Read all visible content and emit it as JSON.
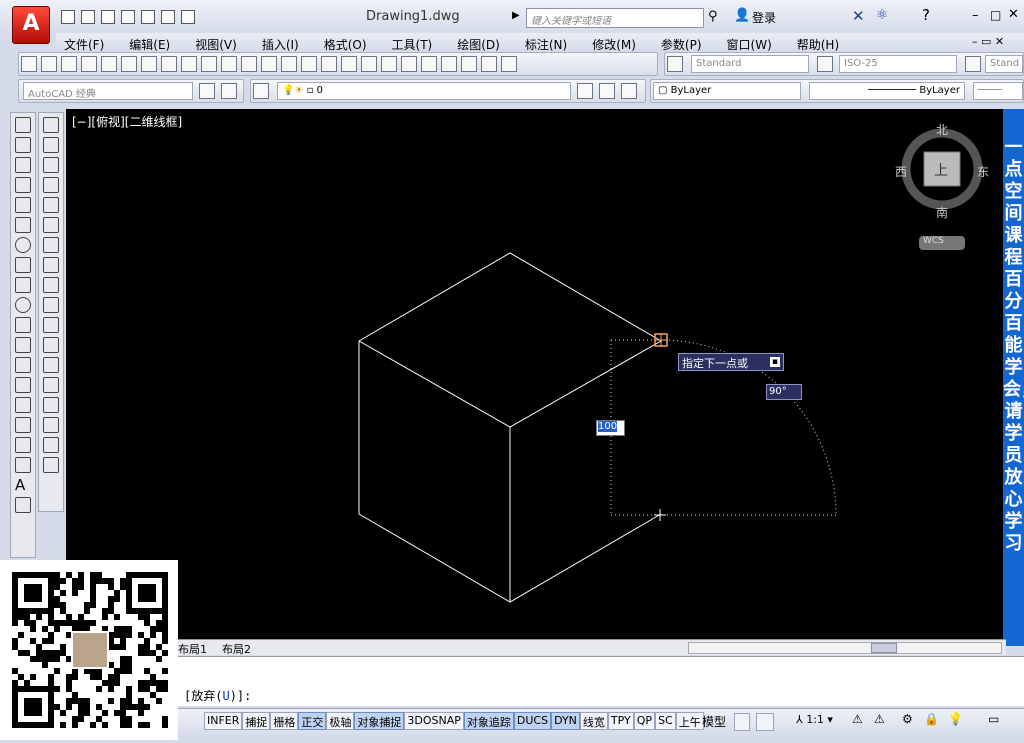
{
  "app": {
    "doc_title": "Drawing1.dwg",
    "search_placeholder": "键入关键字或短语",
    "login": "登录",
    "app_letter": "A"
  },
  "menu": [
    "文件(F)",
    "编辑(E)",
    "视图(V)",
    "插入(I)",
    "格式(O)",
    "工具(T)",
    "绘图(D)",
    "标注(N)",
    "修改(M)",
    "参数(P)",
    "窗口(W)",
    "帮助(H)"
  ],
  "toolbar": {
    "text_style": "Standard",
    "dim_style": "ISO-25",
    "table_style": "Stand",
    "workspace": "AutoCAD 经典",
    "layer": "0",
    "color": "ByLayer",
    "linetype": "ByLayer"
  },
  "viewport": {
    "label": "[−][俯视][二维线框]"
  },
  "viewcube": {
    "north": "北",
    "south": "南",
    "east": "东",
    "west": "西",
    "top": "上",
    "wcs": "WCS"
  },
  "dynamic_input": {
    "prompt": "指定下一点或",
    "angle": "90°",
    "distance": "100"
  },
  "layout_tabs": [
    "布局1",
    "布局2"
  ],
  "command": {
    "line": "[放弃(U)]:",
    "undo_key": "U"
  },
  "status": {
    "buttons": [
      "INFER",
      "捕捉",
      "栅格",
      "正交",
      "极轴",
      "对象捕捉",
      "3DOSNAP",
      "对象追踪",
      "DUCS",
      "DYN",
      "线宽",
      "TPY",
      "QP",
      "SC",
      "上午"
    ],
    "active": [
      "正交",
      "对象捕捉",
      "对象追踪",
      "DUCS",
      "DYN"
    ],
    "model": "模型",
    "scale": "1:1"
  },
  "banner": "一点空间课程百分百能学会，请学员放心学习"
}
